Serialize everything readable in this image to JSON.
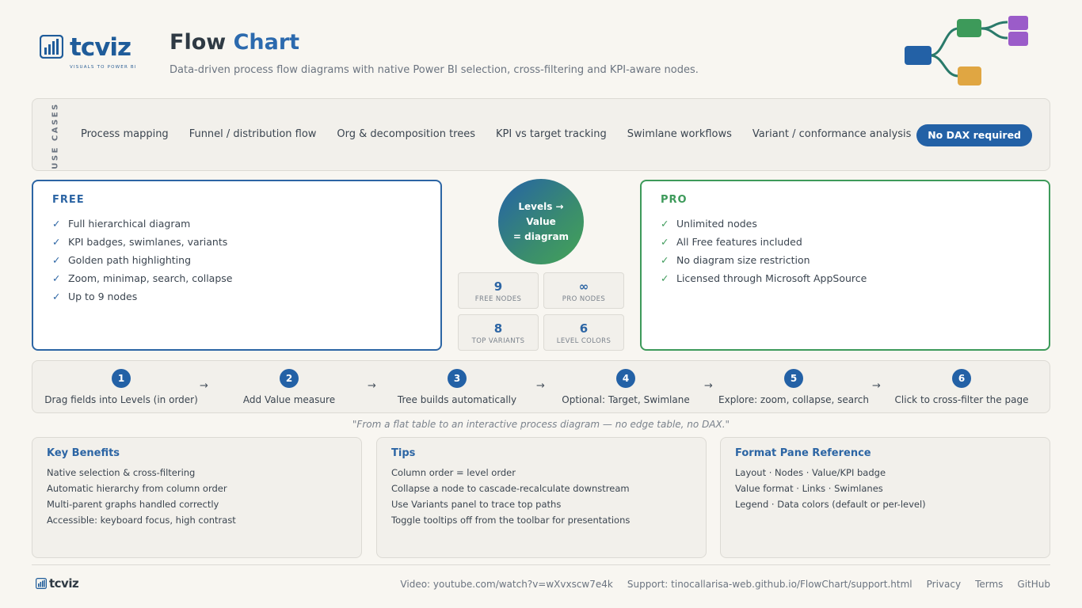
{
  "brand": {
    "name": "tcviz",
    "tagline": "VISUALS TO POWER BI"
  },
  "header": {
    "title_part1": "Flow",
    "title_part2": "Chart",
    "subtitle": "Data-driven process flow diagrams with native Power BI selection, cross-filtering and KPI-aware nodes."
  },
  "use_cases": {
    "label": "USE CASES",
    "items": [
      "Process mapping",
      "Funnel / distribution flow",
      "Org & decomposition trees",
      "KPI vs target tracking",
      "Swimlane workflows",
      "Variant / conformance analysis"
    ],
    "pill": "No DAX required"
  },
  "free": {
    "title": "FREE",
    "features": [
      "Full hierarchical diagram",
      "KPI badges, swimlanes, variants",
      "Golden path highlighting",
      "Zoom, minimap, search, collapse",
      "Up to 9 nodes"
    ]
  },
  "pro": {
    "title": "PRO",
    "features": [
      "Unlimited nodes",
      "All Free features included",
      "No diagram size restriction",
      "Licensed through Microsoft AppSource"
    ]
  },
  "hub": {
    "line1": "Levels →",
    "line2": "Value",
    "line3": "= diagram"
  },
  "stats": [
    {
      "value": "9",
      "label": "FREE NODES"
    },
    {
      "value": "∞",
      "label": "PRO NODES"
    },
    {
      "value": "8",
      "label": "TOP VARIANTS"
    },
    {
      "value": "6",
      "label": "LEVEL COLORS"
    }
  ],
  "steps": [
    {
      "num": "1",
      "label": "Drag fields into Levels (in order)"
    },
    {
      "num": "2",
      "label": "Add Value measure"
    },
    {
      "num": "3",
      "label": "Tree builds automatically"
    },
    {
      "num": "4",
      "label": "Optional: Target, Swimlane"
    },
    {
      "num": "5",
      "label": "Explore: zoom, collapse, search"
    },
    {
      "num": "6",
      "label": "Click to cross-filter the page"
    }
  ],
  "arrow_glyph": "→",
  "quote": "\"From a flat table to an interactive process diagram — no edge table, no DAX.\"",
  "benefits": {
    "title": "Key Benefits",
    "items": [
      "Native selection & cross-filtering",
      "Automatic hierarchy from column order",
      "Multi-parent graphs handled correctly",
      "Accessible: keyboard focus, high contrast"
    ]
  },
  "tips": {
    "title": "Tips",
    "items": [
      "Column order = level order",
      "Collapse a node to cascade-recalculate downstream",
      "Use Variants panel to trace top paths",
      "Toggle tooltips off from the toolbar for presentations"
    ]
  },
  "format_pane": {
    "title": "Format Pane Reference",
    "items": [
      "Layout · Nodes · Value/KPI badge",
      "Value format · Links · Swimlanes",
      "Legend · Data colors (default or per-level)"
    ]
  },
  "footer": {
    "brand": "tcviz",
    "links": [
      "Video: youtube.com/watch?v=wXvxscw7e4k",
      "Support: tinocallarisa-web.github.io/FlowChart/support.html",
      "Privacy",
      "Terms",
      "GitHub"
    ]
  },
  "colors": {
    "primary_blue": "#2361a6",
    "pro_green": "#3d9a5a",
    "node_orange": "#e0a642",
    "node_purple": "#9b5cc9"
  }
}
